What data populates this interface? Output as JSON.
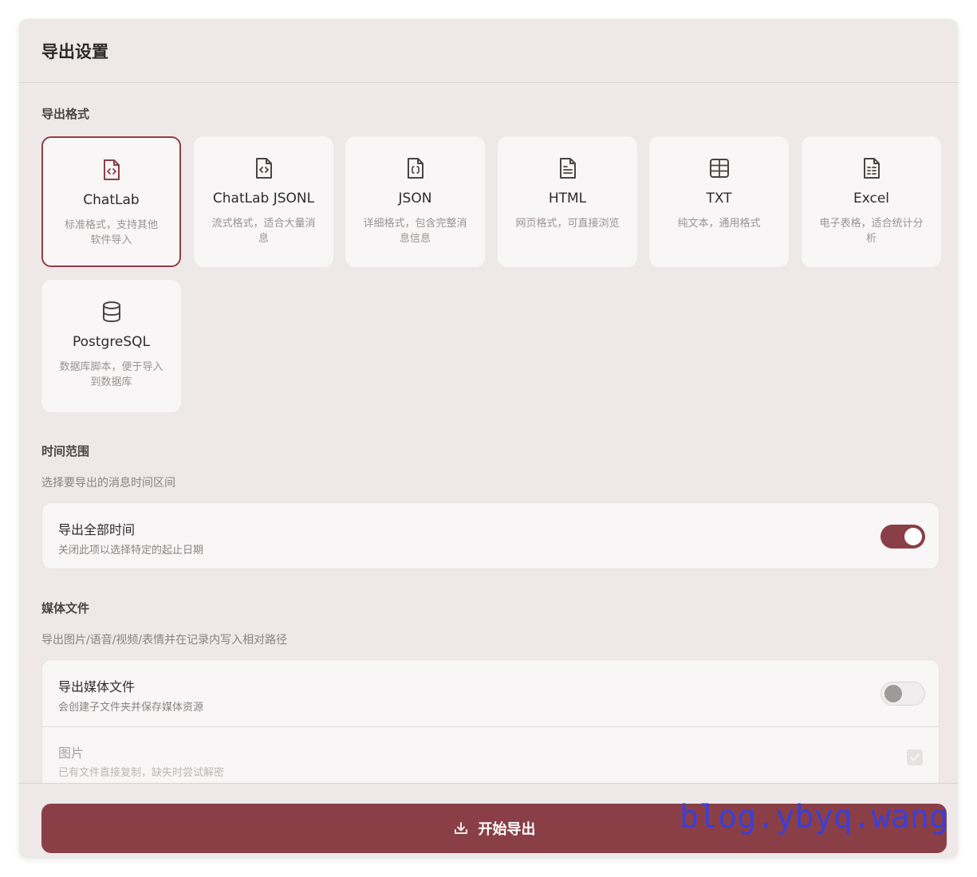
{
  "panel": {
    "title": "导出设置"
  },
  "format_section": {
    "label": "导出格式",
    "formats": [
      {
        "name": "ChatLab",
        "desc": "标准格式，支持其他软件导入",
        "icon": "file-code-icon",
        "selected": true
      },
      {
        "name": "ChatLab JSONL",
        "desc": "流式格式，适合大量消息",
        "icon": "file-code-icon",
        "selected": false
      },
      {
        "name": "JSON",
        "desc": "详细格式，包含完整消息信息",
        "icon": "file-json-icon",
        "selected": false
      },
      {
        "name": "HTML",
        "desc": "网页格式，可直接浏览",
        "icon": "file-text-icon",
        "selected": false
      },
      {
        "name": "TXT",
        "desc": "纯文本，通用格式",
        "icon": "table-icon",
        "selected": false
      },
      {
        "name": "Excel",
        "desc": "电子表格，适合统计分析",
        "icon": "file-spreadsheet-icon",
        "selected": false
      },
      {
        "name": "PostgreSQL",
        "desc": "数据库脚本，便于导入到数据库",
        "icon": "database-icon",
        "selected": false
      }
    ]
  },
  "time_section": {
    "label": "时间范围",
    "desc": "选择要导出的消息时间区间",
    "toggle_title": "导出全部时间",
    "toggle_sub": "关闭此项以选择特定的起止日期",
    "toggle_on": true
  },
  "media_section": {
    "label": "媒体文件",
    "desc": "导出图片/语音/视频/表情并在记录内写入相对路径",
    "toggle_title": "导出媒体文件",
    "toggle_sub": "会创建子文件夹并保存媒体资源",
    "toggle_on": false,
    "image_title": "图片",
    "image_sub": "已有文件直接复制，缺失时尝试解密",
    "image_checked": true
  },
  "footer": {
    "export_label": "开始导出"
  },
  "watermark": "blog.ybyq.wang",
  "colors": {
    "accent": "#8a3f47",
    "panel_bg": "#eee8e8",
    "card_bg": "#f8f6f6",
    "watermark": "#3b3fd6"
  }
}
